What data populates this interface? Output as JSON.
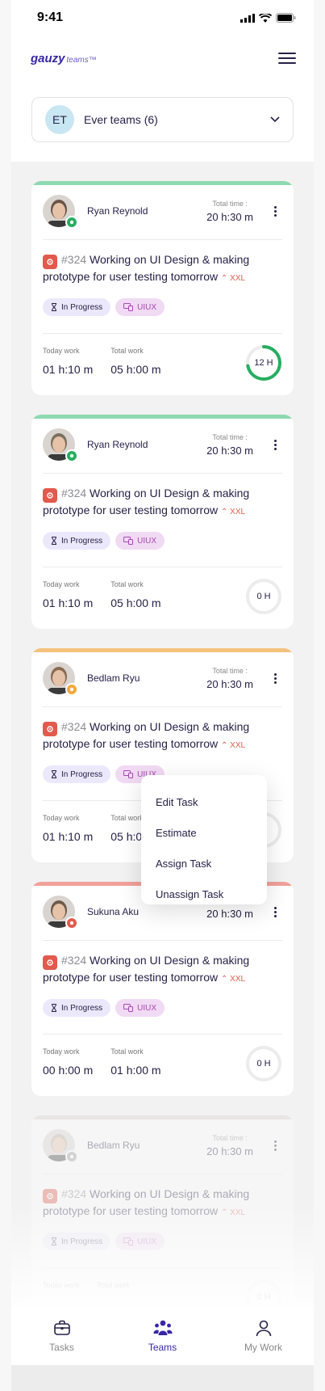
{
  "status_bar": {
    "time": "9:41"
  },
  "header": {
    "logo_main": "gauzy",
    "logo_sub": "teams™"
  },
  "team_select": {
    "initials": "ET",
    "name": "Ever teams (6)"
  },
  "cards": [
    {
      "user": "Ryan Reynold",
      "status": "working",
      "status_color": "#27ae60",
      "accent": "#8ed9b0",
      "total_time_label": "Total time :",
      "total_time": "20 h:30 m",
      "task_number": "#324",
      "task_title": "Working on UI Design & making prototype for user testing tomorrow",
      "size": "XXL",
      "status_tag": "In Progress",
      "label_tag": "UIUX",
      "today_label": "Today work",
      "today": "01 h:10 m",
      "total_label": "Total work",
      "total": "05 h:00 m",
      "estimate": "12 H",
      "estimate_progress": 0.72,
      "ring_color": "#27ae60"
    },
    {
      "user": "Ryan Reynold",
      "status": "online",
      "status_color": "#27ae60",
      "accent": "#8ed9b0",
      "total_time_label": "Total time :",
      "total_time": "20 h:30 m",
      "task_number": "#324",
      "task_title": "Working on UI Design & making prototype for user testing tomorrow",
      "size": "XXL",
      "status_tag": "In Progress",
      "label_tag": "UIUX",
      "today_label": "Today work",
      "today": "01 h:10 m",
      "total_label": "Total work",
      "total": "05 h:00 m",
      "estimate": "0 H",
      "estimate_progress": 0,
      "ring_color": "#ececec"
    },
    {
      "user": "Bedlam Ryu",
      "status": "paused",
      "status_color": "#f2a93b",
      "accent": "#f4c27d",
      "total_time_label": "Total time :",
      "total_time": "20 h:30 m",
      "task_number": "#324",
      "task_title": "Working on UI Design & making prototype for user testing tomorrow",
      "size": "XXL",
      "status_tag": "In Progress",
      "label_tag": "UIUX",
      "today_label": "Today work",
      "today": "01 h:10 m",
      "total_label": "Total work",
      "total": "05 h:0",
      "estimate": "",
      "estimate_progress": 0,
      "ring_color": "#27ae60"
    },
    {
      "user": "Sukuna Aku",
      "status": "offline",
      "status_color": "#e25a4d",
      "accent": "#f1a19a",
      "total_time_label": "",
      "total_time": "20 h:30 m",
      "task_number": "#324",
      "task_title": "Working on UI Design & making prototype for user testing tomorrow",
      "size": "XXL",
      "status_tag": "In Progress",
      "label_tag": "UIUX",
      "today_label": "Today work",
      "today": "00 h:00 m",
      "total_label": "Total work",
      "total": "01 h:00 m",
      "estimate": "0 H",
      "estimate_progress": 0,
      "ring_color": "#ececec"
    },
    {
      "user": "Bedlam Ryu",
      "status": "idle",
      "status_color": "#9a9a9a",
      "accent": "#d9cfc8",
      "total_time_label": "Total time :",
      "total_time": "20 h:30 m",
      "task_number": "#324",
      "task_title": "Working on UI Design & making prototype for user testing tomorrow",
      "size": "XXL",
      "status_tag": "In Progress",
      "label_tag": "UIUX",
      "today_label": "Today work",
      "today": "",
      "total_label": "Total work",
      "total": "",
      "estimate": "0 H",
      "estimate_progress": 0,
      "ring_color": "#ececec"
    }
  ],
  "context_menu": {
    "items": [
      "Edit Task",
      "Estimate",
      "Assign Task",
      "Unassign Task"
    ]
  },
  "tabbar": {
    "tabs": [
      {
        "label": "Tasks",
        "icon": "briefcase-icon"
      },
      {
        "label": "Teams",
        "icon": "people-icon",
        "active": true
      },
      {
        "label": "My Work",
        "icon": "user-icon"
      }
    ]
  },
  "colors": {
    "brand": "#3826a6",
    "danger": "#e25a4d",
    "success": "#27ae60"
  }
}
